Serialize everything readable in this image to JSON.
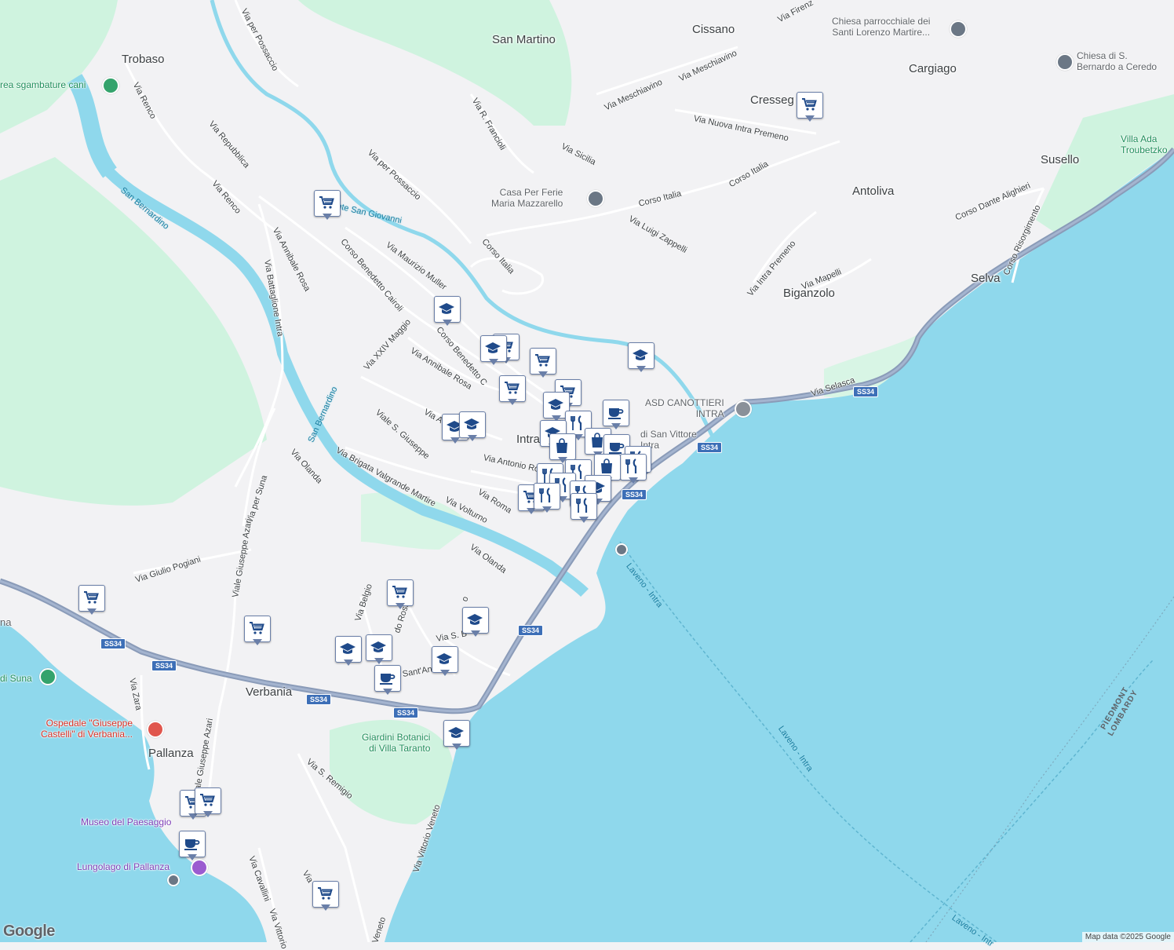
{
  "places": {
    "trobaso": "Trobaso",
    "san_martino": "San Martino",
    "cissano": "Cissano",
    "cargiago": "Cargiago",
    "cresseglio": "Cresseg",
    "antoliva": "Antoliva",
    "susello": "Susello",
    "selva": "Selva",
    "biganzolo": "Biganzolo",
    "intra": "Intra",
    "verbania": "Verbania",
    "pallanza": "Pallanza"
  },
  "pois": {
    "chiesa_lorenzo": "Chiesa parrocchiale dei\nSanti Lorenzo Martire...",
    "chiesa_bernardo": "Chiesa di S.\nBernardo a Ceredo",
    "villa_ada": "Villa Ada\nTroubetzko",
    "casa_ferie": "Casa Per Ferie\nMaria Mazzarello",
    "asd": "ASD CANOTTIERI\nINTRA",
    "san_vittore": "di San Vittore\nIntra",
    "area_cani": "rea sgambature cani",
    "di_suna": "di Suna",
    "ospedale": "Ospedale \"Giuseppe\nCastelli\" di Verbania...",
    "giardini": "Giardini Botanici\ndi Villa Taranto",
    "museo": "Museo del Paesaggio",
    "lungolago": "Lungolago di Pallanza",
    "na": "na"
  },
  "roads": {
    "via_per_possaccio_top": "Via per Possaccio",
    "via_renco_1": "Via Renco",
    "via_repubblica": "Via Repubblica",
    "via_renco_2": "Via Renco",
    "via_annibale_rosa_1": "Via Annibale Rosa",
    "via_battaglione": "Via Battaglione Intra",
    "corso_cairoli": "Corso Benedetto Cairoli",
    "via_maurizio_muller": "Via Maurizio Muller",
    "via_per_possaccio": "Via per Possaccio",
    "torrente": "Torrente San Giovanni",
    "via_francioli": "Via R. Francioli",
    "via_meschiavino_1": "Via Meschiavino",
    "via_meschiavino_2": "Via Meschiavino",
    "via_sicilia": "Via Sicilia",
    "via_nuova_intra": "Via Nuova Intra Premeno",
    "corso_italia_1": "Corso Italia",
    "corso_italia_2": "Corso Italia",
    "corso_italia_3": "Corso Italia",
    "via_luigi_zappelli": "Via Luigi Zappelli",
    "via_intra_premeno": "Via Intra Premeno",
    "via_mapelli": "Via Mapelli",
    "corso_dante": "Corso Dante Alighieri",
    "corso_risorgimento": "Corso Risorgimento",
    "via_firenze": "Via Firenz",
    "via_selasca": "Via Selasca",
    "via_xxiv_maggio": "Via XXIV Maggio",
    "via_annibale_rosa_2": "Via Annibale Rosa",
    "corso_cairoli_2": "Corso Benedetto C",
    "viale_s_giuseppe": "Viale S. Giuseppe",
    "via_a": "Via A",
    "via_antonio_rosmini": "Via Antonio Ros",
    "via_brigata": "Via Brigata Valgrande Martire",
    "via_volturno": "Via Volturno",
    "via_roma": "Via Roma",
    "via_olanda_1": "Via Olanda",
    "via_olanda_2": "Via Olanda",
    "via_per_suna": "Via per Suna",
    "viale_azari_1": "Viale Giuseppe Azari",
    "via_giulio_pogiani": "Via Giulio Pogiani",
    "via_belgio": "Via Belgio",
    "via_rosso": "do Ross",
    "via_s_b": "Via S. B",
    "via_sant_an": "Sant'An",
    "via_zara": "Via Zara",
    "viale_azari_2": "ale Giuseppe Azari",
    "via_s_remigio": "Via S. Remigio",
    "via_vittorio_veneto": "Via Vittorio Veneto",
    "via_cavallini": "Via Cavallini",
    "via_vittorio": "Via Vittorio",
    "via_veneto": "Veneto",
    "via_s": "Via",
    "via_g": "o"
  },
  "water": {
    "san_bernardino_1": "San Bernardino",
    "san_bernardino_2": "San Bernardino",
    "laveno_1": "Laveno - Intra",
    "laveno_2": "Laveno - Intra",
    "laveno_3": "Laveno - Intr"
  },
  "boundary": {
    "label": "PIEDMONT\nLOMBARDY"
  },
  "shields": {
    "ss34": "SS34"
  },
  "branding": {
    "logo": "Google",
    "attribution": "Map data ©2025 Google"
  },
  "colors": {
    "lake": "#8fd8ec",
    "land": "#f2f2f4",
    "park": "#c9f2dc",
    "main_road": "#8a9bb8",
    "marker_icon": "#1f4a8a"
  }
}
